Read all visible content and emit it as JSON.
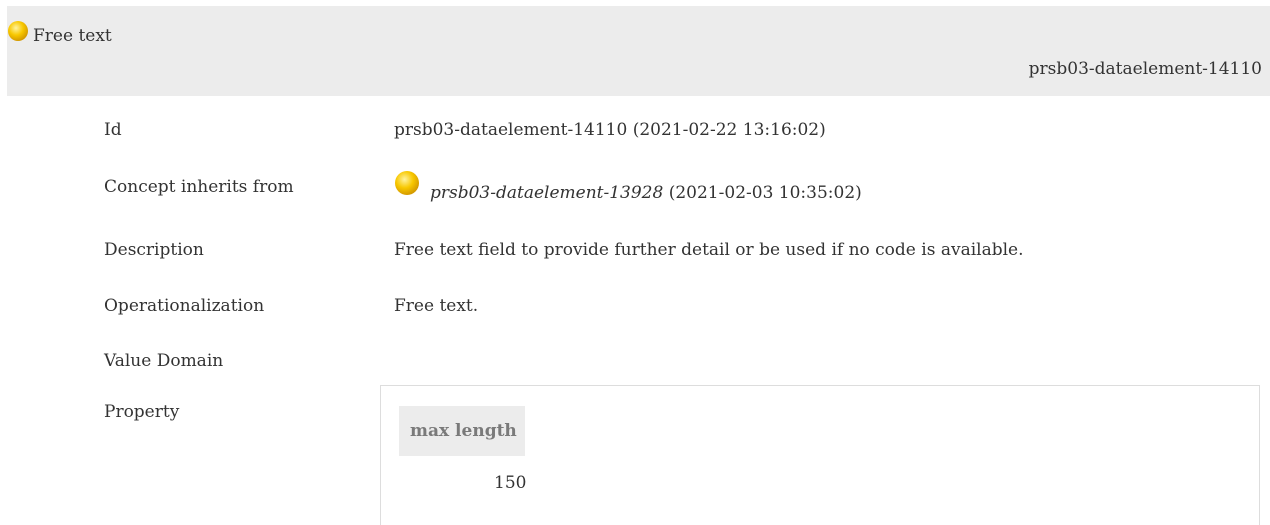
{
  "header": {
    "title": "Free text",
    "id": "prsb03-dataelement-14110",
    "status_icon": "yellow-status-dot-icon",
    "status_color": "#f6c300"
  },
  "details": {
    "id_label": "Id",
    "id_value": "prsb03-dataelement-14110 (2021-02-22 13:16:02)",
    "inherits_label": "Concept inherits from",
    "inherits_ref": "prsb03-dataelement-13928",
    "inherits_date": " (2021-02-03 10:35:02)",
    "description_label": "Description",
    "description_value": "Free text field to provide further detail or be used if no code is available.",
    "operationalization_label": "Operationalization",
    "operationalization_value": "Free text.",
    "value_domain_label": "Value Domain",
    "property_label": "Property"
  },
  "property_table": {
    "column_header": "max length",
    "value": "150"
  }
}
